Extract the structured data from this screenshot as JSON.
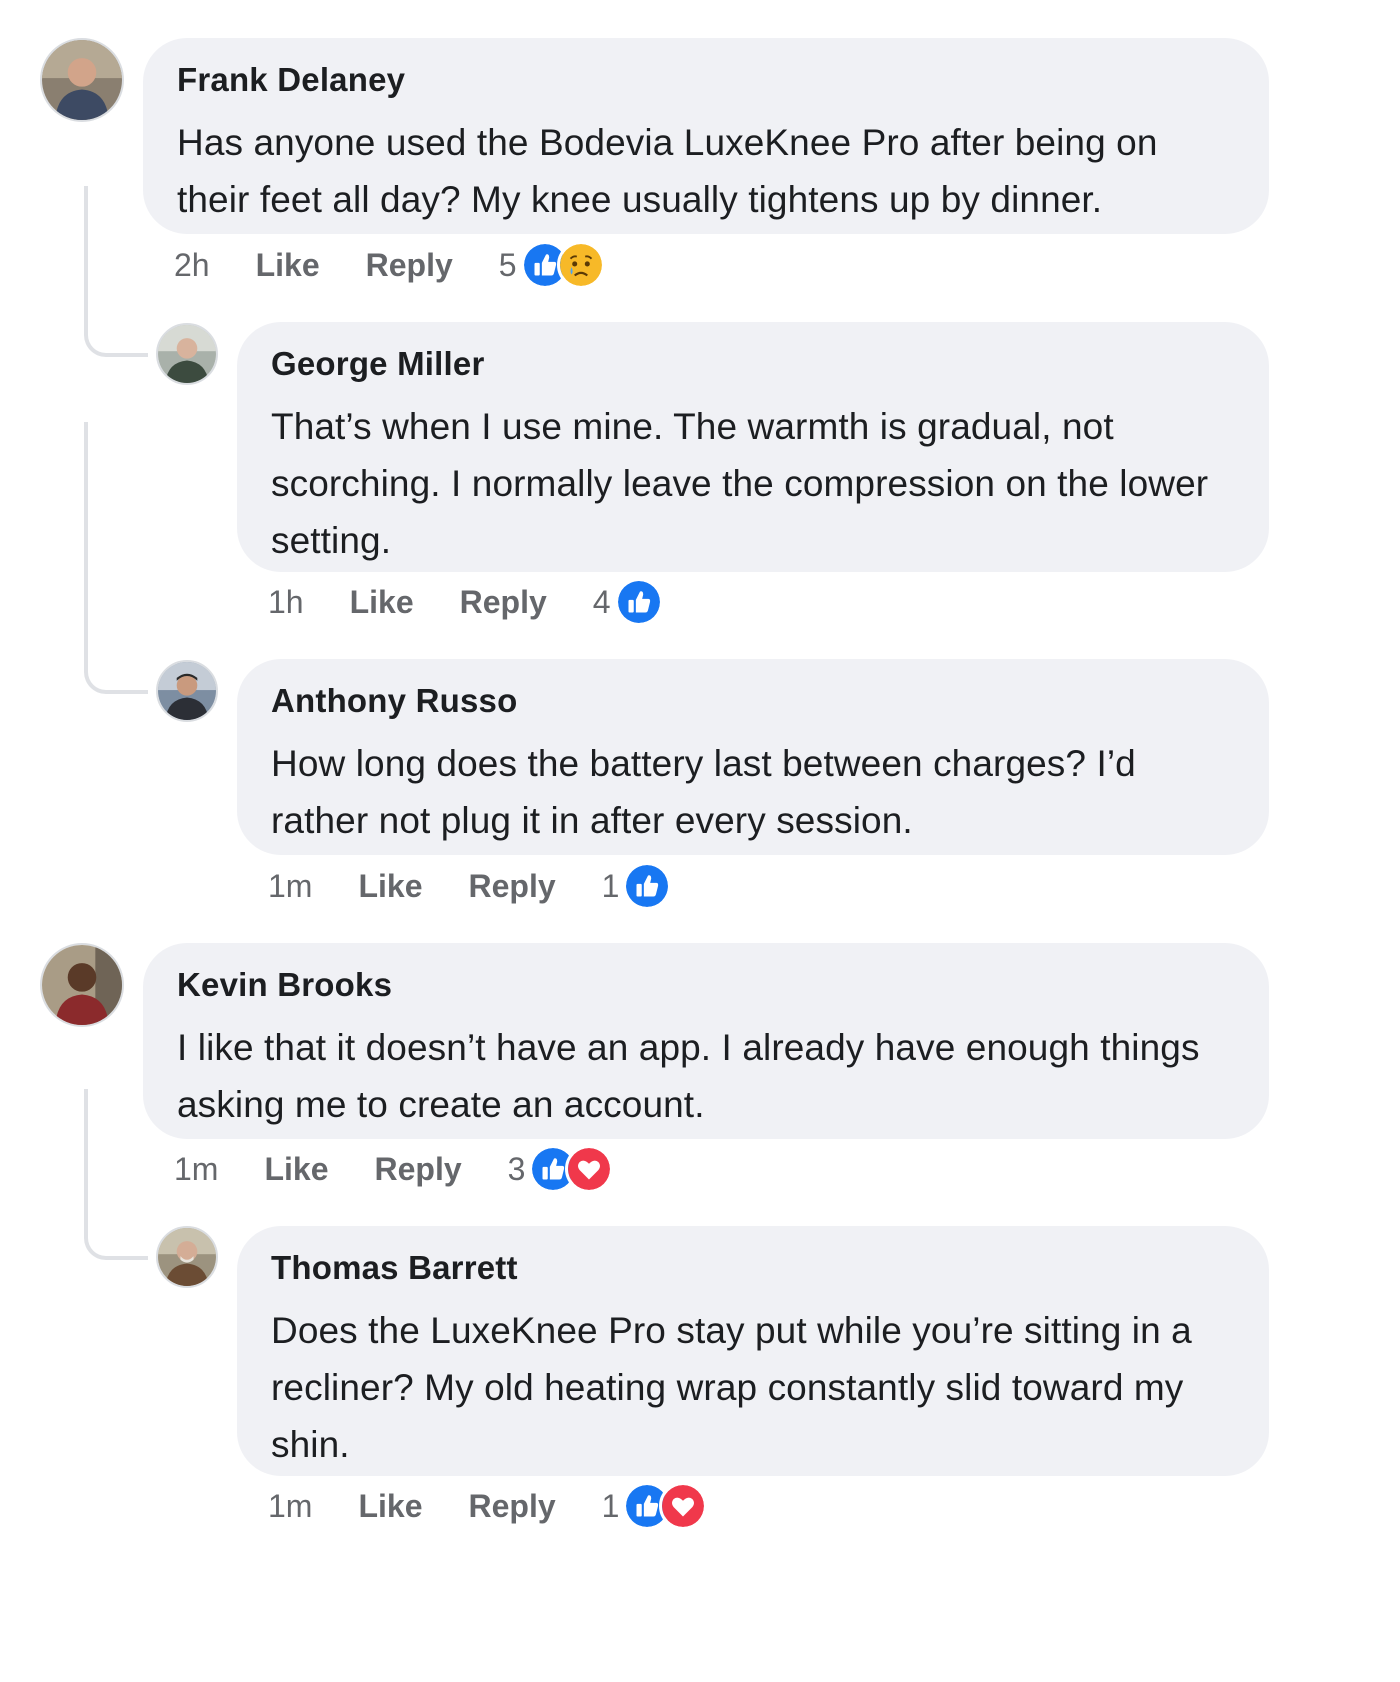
{
  "comments": [
    {
      "author": "Frank Delaney",
      "text": "Has anyone used the Bodevia LuxeKnee Pro after being on their feet all day? My knee usually tightens up by dinner.",
      "time": "2h",
      "like_label": "Like",
      "reply_label": "Reply",
      "reaction_count": "5",
      "reactions": [
        "like-icon",
        "sad-icon"
      ],
      "replies": [
        {
          "author": "George Miller",
          "text": "That’s when I use mine. The warmth is gradual, not scorching. I normally leave the compression on the lower setting.",
          "time": "1h",
          "like_label": "Like",
          "reply_label": "Reply",
          "reaction_count": "4",
          "reactions": [
            "like-icon"
          ]
        },
        {
          "author": "Anthony Russo",
          "text": "How long does the battery last between charges? I’d rather not plug it in after every session.",
          "time": "1m",
          "like_label": "Like",
          "reply_label": "Reply",
          "reaction_count": "1",
          "reactions": [
            "like-icon"
          ]
        }
      ]
    },
    {
      "author": "Kevin Brooks",
      "text": "I like that it doesn’t have an app. I already have enough things asking me to create an account.",
      "time": "1m",
      "like_label": "Like",
      "reply_label": "Reply",
      "reaction_count": "3",
      "reactions": [
        "like-icon",
        "love-icon"
      ],
      "replies": [
        {
          "author": "Thomas Barrett",
          "text": "Does the LuxeKnee Pro stay put while you’re sitting in a recliner? My old heating wrap constantly slid toward my shin.",
          "time": "1m",
          "like_label": "Like",
          "reply_label": "Reply",
          "reaction_count": "1",
          "reactions": [
            "like-icon",
            "love-icon"
          ]
        }
      ]
    }
  ],
  "colors": {
    "like_blue": "#1877f2",
    "love_red": "#f0384b",
    "sad_yellow": "#f7b928",
    "bubble_bg": "#f0f1f5",
    "meta_gray": "#65676b"
  }
}
